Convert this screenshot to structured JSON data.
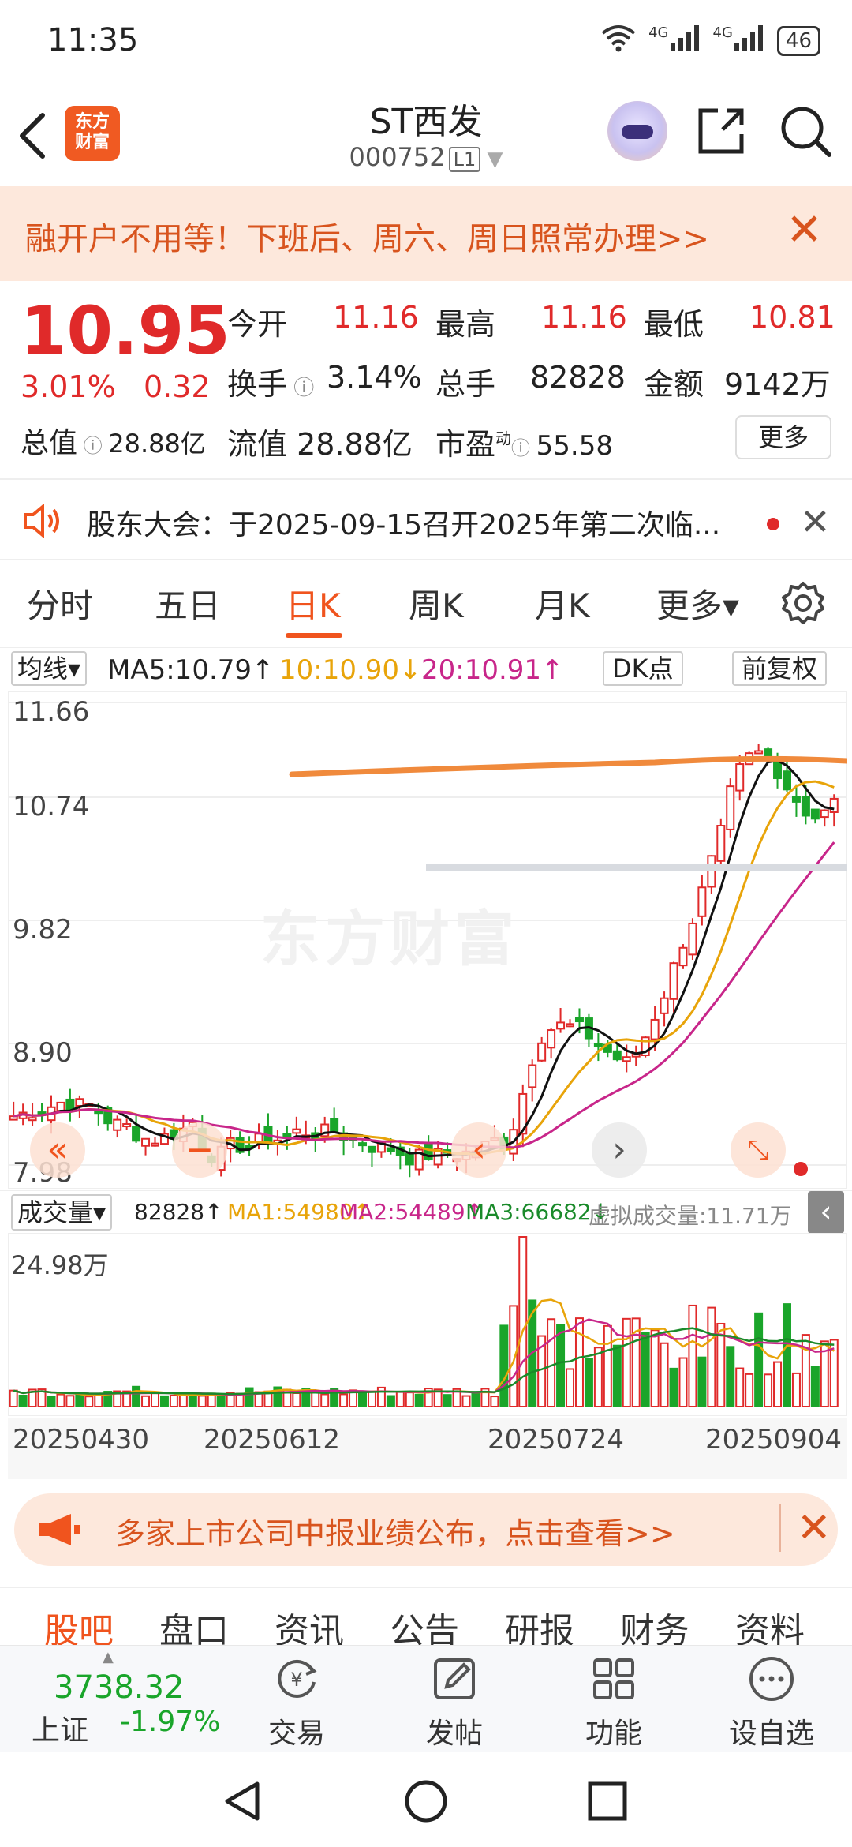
{
  "status_bar": {
    "time": "11:35",
    "signal1": "4G",
    "signal2": "4G",
    "battery": "46"
  },
  "header": {
    "stock_name": "ST西发",
    "stock_code": "000752",
    "level_badge": "L1",
    "logo_text_1": "东方",
    "logo_text_2": "财富"
  },
  "banner_top": {
    "text": "融开户不用等！下班后、周六、周日照常办理>>",
    "close": "✕"
  },
  "quote": {
    "price": "10.95",
    "change_pct": "3.01%",
    "change": "0.32",
    "open_label": "今开",
    "open": "11.16",
    "high_label": "最高",
    "high": "11.16",
    "low_label": "最低",
    "low": "10.81",
    "turnover_label": "换手",
    "turnover": "3.14%",
    "volume_label": "总手",
    "volume": "82828",
    "amount_label": "金额",
    "amount": "9142万",
    "mcap_label": "总值",
    "mcap": "28.88亿",
    "float_label": "流值",
    "float": "28.88亿",
    "pe_label": "市盈",
    "pe_sup": "动",
    "pe": "55.58",
    "more": "更多"
  },
  "notice": {
    "text": "股东大会：于2025-09-15召开2025年第二次临..."
  },
  "tabs": [
    {
      "label": "分时"
    },
    {
      "label": "五日"
    },
    {
      "label": "日K"
    },
    {
      "label": "周K"
    },
    {
      "label": "月K"
    },
    {
      "label": "更多▾"
    }
  ],
  "ma_bar": {
    "selector": "均线▾",
    "ma5": "MA5:10.79↑",
    "ma10": "10:10.90↓",
    "ma20": "20:10.91↑",
    "dk": "DK点",
    "adjust": "前复权"
  },
  "colors": {
    "up": "#e02a2a",
    "down": "#1aa52a",
    "accent": "#f0541e",
    "ma5": "#111111",
    "ma10": "#e8a40a",
    "ma20": "#c8268a",
    "drawn_line": "#f08a3c"
  },
  "kline": {
    "y_labels": [
      "11.66",
      "10.74",
      "9.82",
      "8.90",
      "7.98"
    ],
    "watermark": "东方财富"
  },
  "volume_bar": {
    "selector": "成交量▾",
    "value": "82828↑",
    "ma1": "MA1:54980↑",
    "ma2": "MA2:54489↑",
    "ma3": "MA3:66682↓",
    "virtual": "虚拟成交量:11.71万",
    "max_label": "24.98万"
  },
  "dates": [
    "20250430",
    "20250612",
    "20250724",
    "20250904"
  ],
  "banner_mid": {
    "text": "多家上市公司中报业绩公布，点击查看>>"
  },
  "bottom_tabs": [
    {
      "label": "股吧"
    },
    {
      "label": "盘口"
    },
    {
      "label": "资讯"
    },
    {
      "label": "公告"
    },
    {
      "label": "研报"
    },
    {
      "label": "财务"
    },
    {
      "label": "资料"
    }
  ],
  "bottom_nav": {
    "index_value": "3738.32",
    "index_name": "上证",
    "index_pct": "-1.97%",
    "trade": "交易",
    "post": "发帖",
    "function": "功能",
    "watch": "设自选"
  }
}
